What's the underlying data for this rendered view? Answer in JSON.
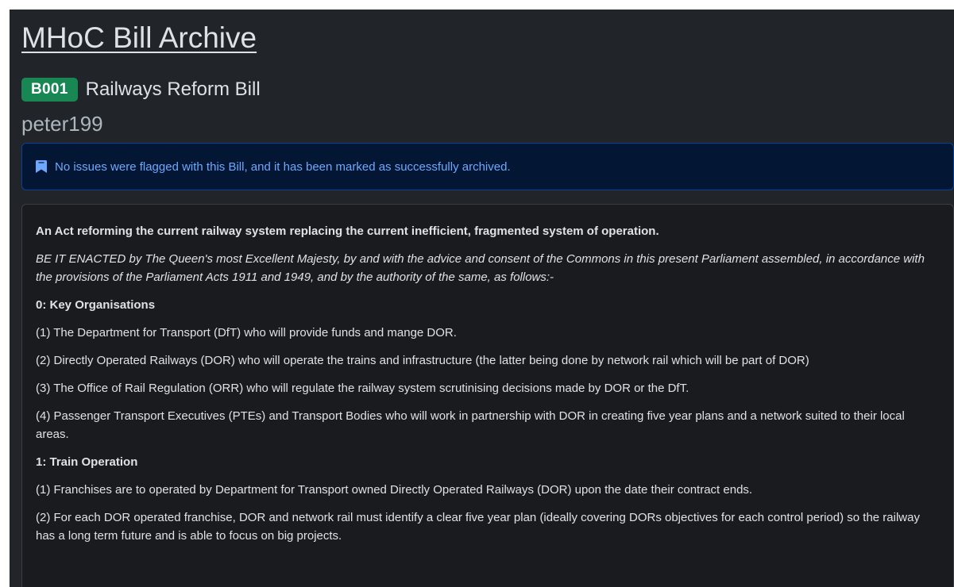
{
  "site": {
    "title": "MHoC Bill Archive"
  },
  "bill": {
    "id": "B001",
    "title": "Railways Reform Bill",
    "author": "peter199"
  },
  "alert": {
    "icon": "bookmark-icon",
    "text": "No issues were flagged with this Bill, and it has been marked as successfully archived.",
    "color": "#6ea8fe"
  },
  "colors": {
    "badge": "#198754",
    "background": "#212529",
    "alert_background": "#031633",
    "alert_border": "#084298"
  },
  "body": {
    "long_title": "An Act reforming the current railway system replacing the current inefficient, fragmented system of operation.",
    "enacting_formula": "BE IT ENACTED by The Queen's most Excellent Majesty, by and with the advice and consent of the Commons in this present Parliament assembled, in accordance with the provisions of the Parliament Acts 1911 and 1949, and by the authority of the same, as follows:-",
    "section0_heading": "0: Key Organisations",
    "section0_items": [
      "(1) The Department for Transport (DfT) who will provide funds and mange DOR.",
      "(2) Directly Operated Railways (DOR) who will operate the trains and infrastructure (the latter being done by network rail which will be part of DOR)",
      "(3) The Office of Rail Regulation (ORR) who will regulate the railway system scrutinising decisions made by DOR or the DfT.",
      "(4) Passenger Transport Executives (PTEs) and Transport Bodies who will work in partnership with DOR in creating five year plans and a network suited to their local areas."
    ],
    "section1_heading": "1: Train Operation",
    "section1_items": [
      "(1) Franchises are to operated by Department for Transport owned Directly Operated Railways (DOR) upon the date their contract ends.",
      "(2) For each DOR operated franchise, DOR and network rail must identify a clear five year plan (ideally covering DORs objectives for each control period) so the railway has a long term future and is able to focus on big projects."
    ]
  }
}
